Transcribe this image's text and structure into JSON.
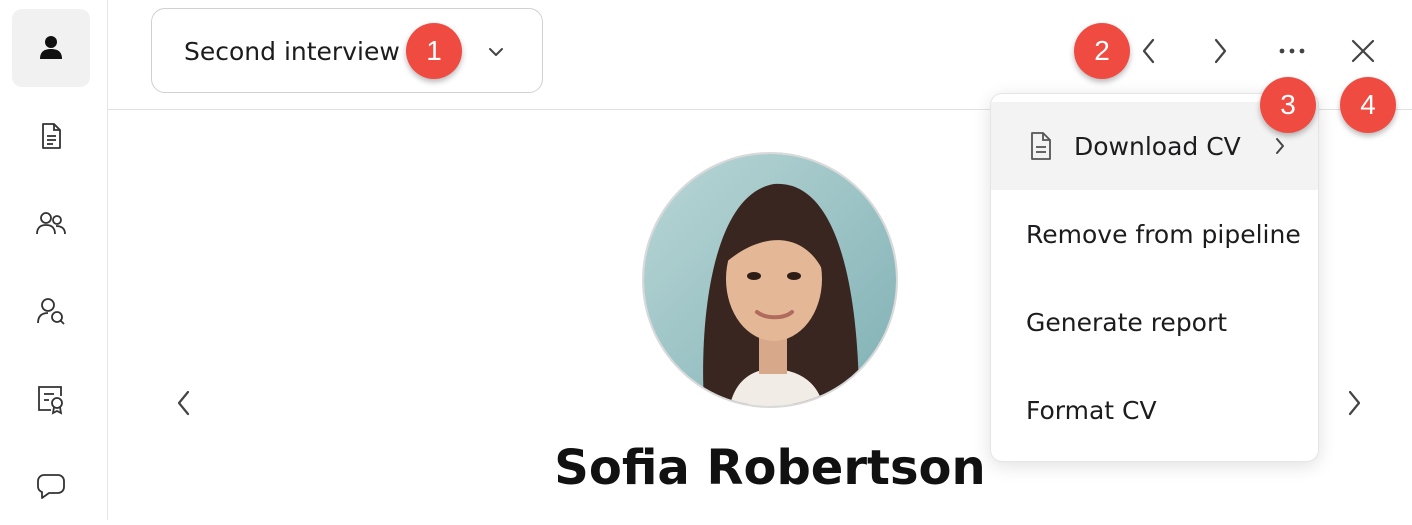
{
  "stage_selector": {
    "label": "Second interview",
    "chevron_icon": "chevron-down-icon"
  },
  "candidate": {
    "name": "Sofia Robertson"
  },
  "header_actions": {
    "prev_icon": "chevron-left-icon",
    "next_icon": "chevron-right-icon",
    "more_icon": "ellipsis-icon",
    "close_icon": "close-icon"
  },
  "sidebar": {
    "items": [
      {
        "icon": "person-icon",
        "active": true
      },
      {
        "icon": "document-icon",
        "active": false
      },
      {
        "icon": "people-icon",
        "active": false
      },
      {
        "icon": "person-search-icon",
        "active": false
      },
      {
        "icon": "certificate-icon",
        "active": false
      },
      {
        "icon": "chat-bubble-icon",
        "active": false
      }
    ]
  },
  "more_menu": {
    "items": [
      {
        "label": "Download CV",
        "icon": "document-icon",
        "has_submenu": true
      },
      {
        "label": "Remove from pipeline"
      },
      {
        "label": "Generate report"
      },
      {
        "label": "Format CV"
      }
    ]
  },
  "annotations": [
    "1",
    "2",
    "3",
    "4"
  ],
  "colors": {
    "badge": "#ef4b41",
    "menu_highlight": "#f3f3f3",
    "sidebar_active": "#f1f1f1"
  }
}
